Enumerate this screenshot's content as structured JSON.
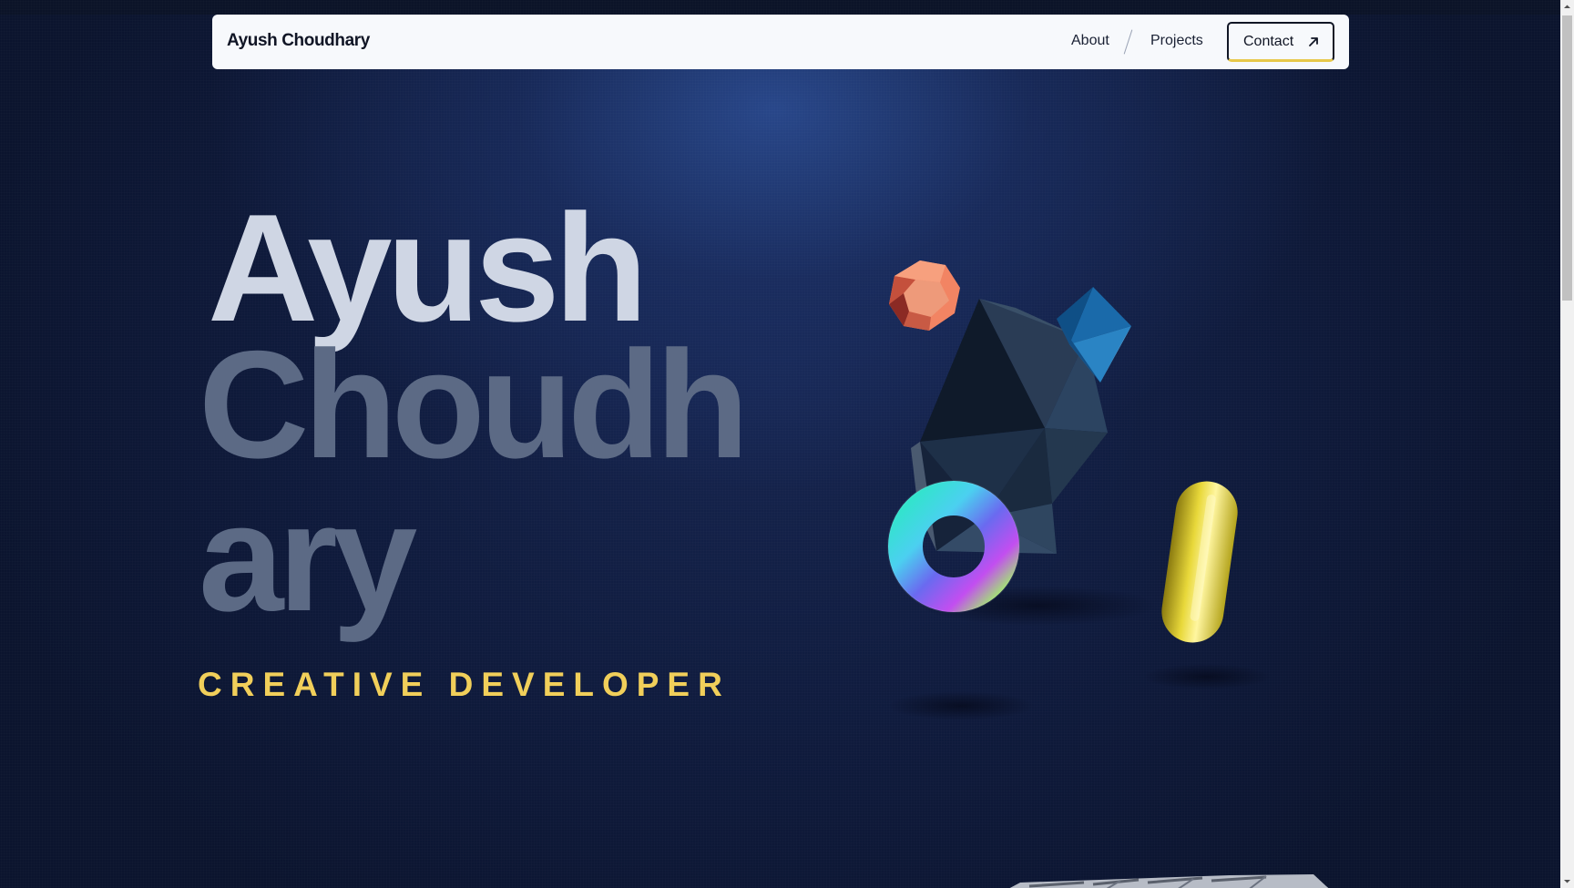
{
  "header": {
    "brand": "Ayush Choudhary",
    "nav": {
      "about": "About",
      "projects": "Projects",
      "contact": "Contact"
    },
    "contact_icon": "arrow-up-right-icon"
  },
  "hero": {
    "first_name": "Ayush",
    "last_name": "Choudhary",
    "role": "CREATIVE DEVELOPER"
  },
  "scene": {
    "objects": [
      "dodecahedron",
      "octahedron",
      "icosahedron",
      "torus",
      "capsule"
    ]
  },
  "colors": {
    "background": "#0f1b3d",
    "accent_yellow": "#f1cf5a",
    "name_light": "#cfd6e4",
    "name_dim": "#5c6a85",
    "nav_bg": "#f7f9fc"
  }
}
